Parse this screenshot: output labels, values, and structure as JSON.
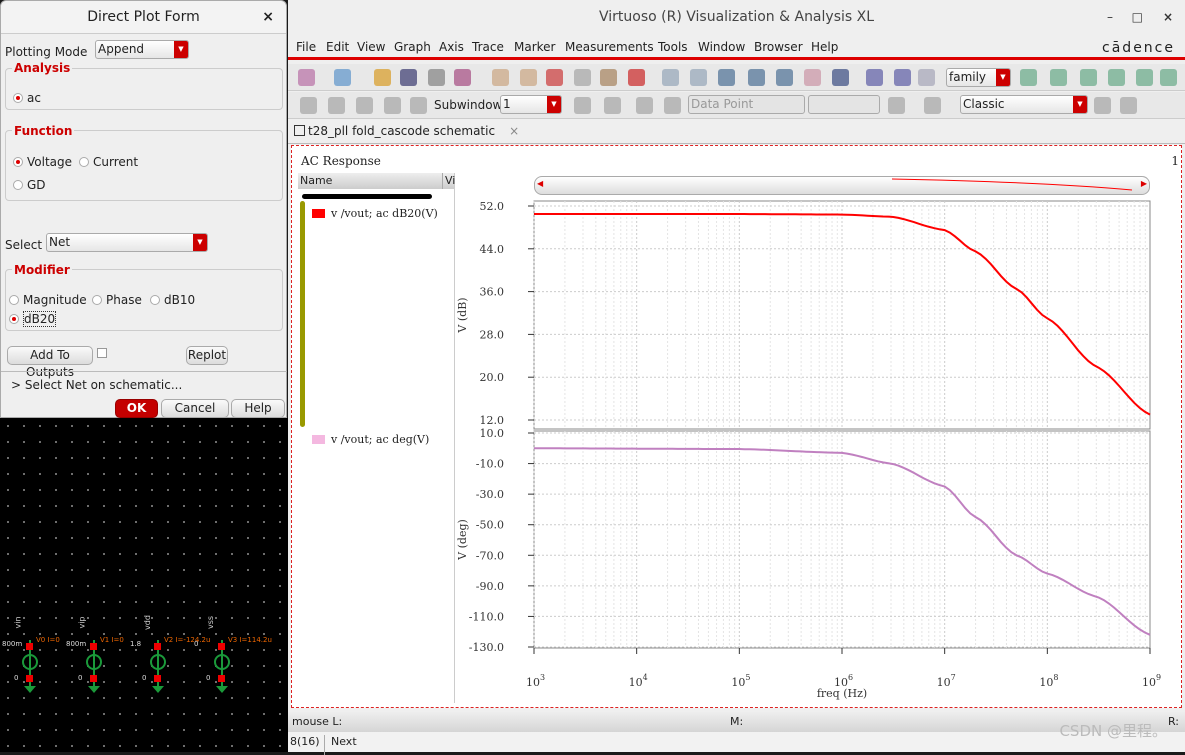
{
  "schematic": {
    "sources": [
      {
        "name": "vin",
        "inst": "V0",
        "dc": "800m",
        "param": "I=0",
        "bot": "0"
      },
      {
        "name": "vip",
        "inst": "V1",
        "dc": "800m",
        "param": "I=0",
        "bot": "0"
      },
      {
        "name": "vdd",
        "inst": "V2",
        "dc": "1.8",
        "param": "I=-124.2u",
        "bot": "0"
      },
      {
        "name": "vss",
        "inst": "V3",
        "dc": "0",
        "param": "I=114.2u",
        "bot": "0"
      }
    ]
  },
  "dialog": {
    "title": "Direct Plot Form",
    "close": "×",
    "plotting_mode_label": "Plotting Mode",
    "plotting_mode": "Append",
    "analysis": {
      "title": "Analysis",
      "options": [
        {
          "label": "ac",
          "selected": true
        }
      ]
    },
    "function": {
      "title": "Function",
      "options": [
        {
          "label": "Voltage",
          "selected": true
        },
        {
          "label": "Current",
          "selected": false
        },
        {
          "label": "GD",
          "selected": false
        }
      ]
    },
    "select_label": "Select",
    "select_value": "Net",
    "modifier": {
      "title": "Modifier",
      "options": [
        {
          "label": "Magnitude",
          "selected": false
        },
        {
          "label": "Phase",
          "selected": false
        },
        {
          "label": "dB10",
          "selected": false
        },
        {
          "label": "dB20",
          "selected": true
        }
      ]
    },
    "add_to_outputs": "Add To Outputs",
    "add_to_outputs_checked": false,
    "replot": "Replot",
    "prompt": "> Select Net on schematic...",
    "ok": "OK",
    "cancel": "Cancel",
    "help": "Help"
  },
  "window": {
    "title": "Virtuoso (R) Visualization & Analysis XL",
    "logo": "cādence",
    "menu": [
      "File",
      "Edit",
      "View",
      "Graph",
      "Axis",
      "Trace",
      "Marker",
      "Measurements",
      "Tools",
      "Window",
      "Browser",
      "Help"
    ],
    "toolbar": {
      "family": "family",
      "subwindow_label": "Subwindow:",
      "subwindow": "1",
      "data_point": "Data Point",
      "style": "Classic"
    },
    "tab": "t28_pll fold_cascode schematic",
    "tab_close": "×"
  },
  "plot": {
    "title": "AC Response",
    "corner": "1",
    "legend_header": [
      "Name",
      "Vi"
    ],
    "traces": [
      {
        "label": "v /vout; ac dB20(V)",
        "color": "#ff0000"
      },
      {
        "label": "v /vout; ac deg(V)",
        "color": "#f4b8e0"
      }
    ]
  },
  "chart_data": [
    {
      "type": "line",
      "xlabel": "freq (Hz)",
      "ylabel": "V (dB)",
      "xscale": "log",
      "xlim": [
        1000,
        1000000000
      ],
      "ylim": [
        12,
        52
      ],
      "yticks": [
        "52.0",
        "44.0",
        "36.0",
        "28.0",
        "20.0",
        "12.0"
      ],
      "xticks": [
        "10^3",
        "10^4",
        "10^5",
        "10^6",
        "10^7",
        "10^8",
        "10^9"
      ],
      "grid": true,
      "series": [
        {
          "name": "v /vout; ac dB20(V)",
          "color": "#ff0000",
          "x": [
            1000,
            100000,
            1000000,
            3000000,
            10000000,
            20000000,
            50000000,
            100000000,
            300000000,
            1000000000
          ],
          "y": [
            50.5,
            50.5,
            50.4,
            50.0,
            47.5,
            43.5,
            36.5,
            31.0,
            22.0,
            13.0
          ]
        }
      ]
    },
    {
      "type": "line",
      "xlabel": "freq (Hz)",
      "ylabel": "V (deg)",
      "xscale": "log",
      "xlim": [
        1000,
        1000000000
      ],
      "ylim": [
        -130,
        10
      ],
      "yticks": [
        "10.0",
        "-10.0",
        "-30.0",
        "-50.0",
        "-70.0",
        "-90.0",
        "-110.0",
        "-130.0"
      ],
      "grid": true,
      "series": [
        {
          "name": "v /vout; ac deg(V)",
          "color": "#c080c0",
          "x": [
            1000,
            100000,
            1000000,
            3000000,
            10000000,
            20000000,
            50000000,
            100000000,
            300000000,
            1000000000
          ],
          "y": [
            0,
            -0.5,
            -3,
            -10,
            -25,
            -45,
            -70,
            -82,
            -97,
            -122
          ]
        }
      ]
    }
  ],
  "status": {
    "mouse_l": "mouse L:",
    "m": "M:",
    "r": "R:",
    "count": "8(16)",
    "next": "Next",
    "watermark": "CSDN @里程。"
  }
}
